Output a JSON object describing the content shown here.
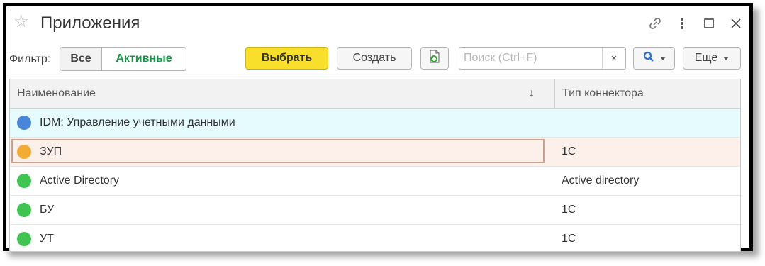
{
  "window": {
    "title": "Приложения",
    "icons": [
      "star-icon",
      "link-icon",
      "more-vertical-icon",
      "maximize-icon",
      "close-icon"
    ]
  },
  "toolbar": {
    "filter_label": "Фильтр:",
    "filter_all": "Все",
    "filter_active": "Активные",
    "select_label": "Выбрать",
    "create_label": "Создать",
    "search_placeholder": "Поиск (Ctrl+F)",
    "clear_label": "×",
    "more_label": "Еще"
  },
  "table": {
    "columns": [
      "Наименование",
      "Тип коннектора"
    ],
    "sort_indicator": "↓",
    "rows": [
      {
        "name": "IDM: Управление учетными данными",
        "type": "",
        "dot_color": "#4a86d8",
        "bg": "#e6fbfd"
      },
      {
        "name": "ЗУП",
        "type": "1С",
        "dot_color": "#f2ac33",
        "bg": "#fdf0ea"
      },
      {
        "name": "Active Directory",
        "type": "Active directory",
        "dot_color": "#3fc452",
        "bg": "#ffffff"
      },
      {
        "name": "БУ",
        "type": "1С",
        "dot_color": "#3fc452",
        "bg": "#ffffff"
      },
      {
        "name": "УТ",
        "type": "1С",
        "dot_color": "#3fc452",
        "bg": "#ffffff"
      }
    ]
  },
  "colors": {
    "primary_button": "#f7df2b",
    "active_filter_text": "#1e9448",
    "selected_row": "#e6fbfd",
    "current_row": "#fdf0ea"
  }
}
